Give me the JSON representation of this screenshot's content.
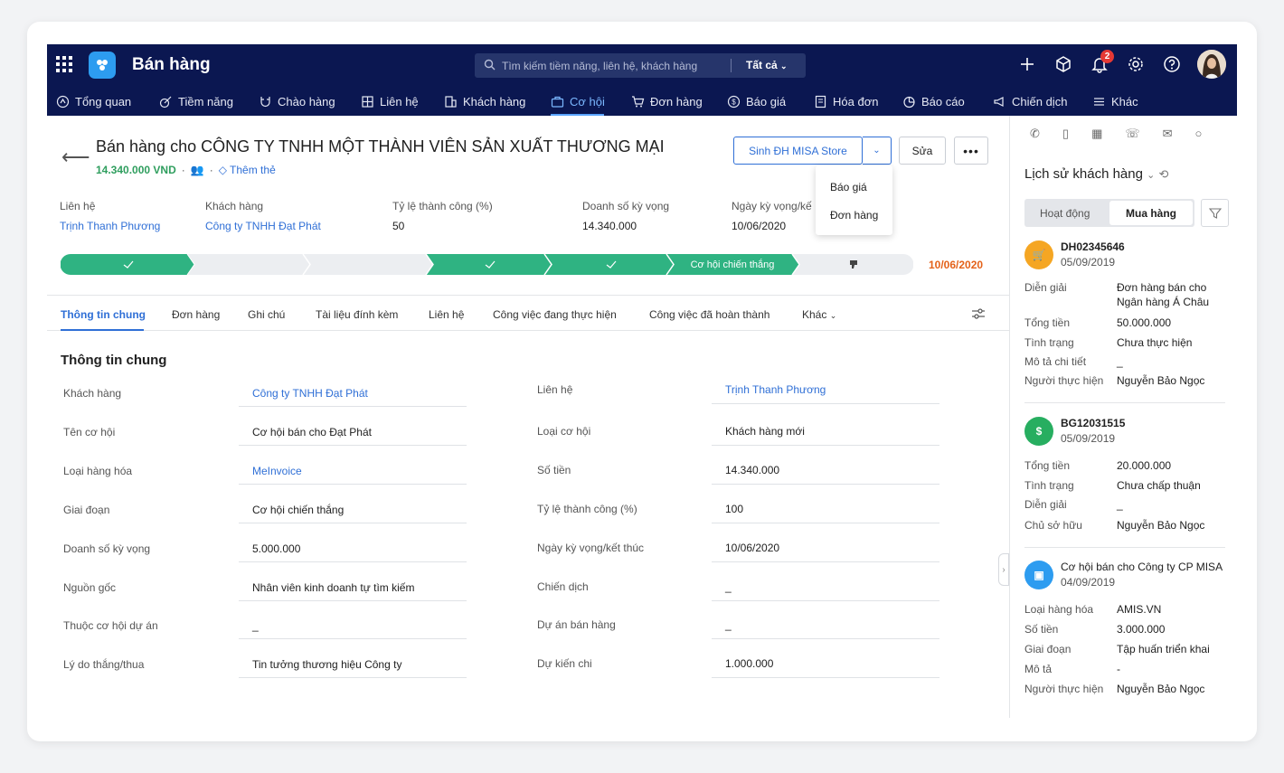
{
  "app": {
    "name": "Bán hàng"
  },
  "search": {
    "placeholder": "Tìm kiếm tiềm năng, liên hệ, khách hàng",
    "scope": "Tất cả"
  },
  "notifications": {
    "count": "2"
  },
  "nav": [
    {
      "label": "Tổng quan",
      "icon": "home-icon"
    },
    {
      "label": "Tiềm năng",
      "icon": "target-icon"
    },
    {
      "label": "Chào hàng",
      "icon": "magnet-icon"
    },
    {
      "label": "Liên hệ",
      "icon": "contact-icon"
    },
    {
      "label": "Khách hàng",
      "icon": "building-icon"
    },
    {
      "label": "Cơ hội",
      "icon": "briefcase-icon",
      "active": true
    },
    {
      "label": "Đơn hàng",
      "icon": "cart-icon"
    },
    {
      "label": "Báo giá",
      "icon": "dollar-icon"
    },
    {
      "label": "Hóa đơn",
      "icon": "invoice-icon"
    },
    {
      "label": "Báo cáo",
      "icon": "pie-icon"
    },
    {
      "label": "Chiến dịch",
      "icon": "megaphone-icon"
    },
    {
      "label": "Khác",
      "icon": "menu-icon"
    }
  ],
  "header": {
    "title": "Bán hàng cho CÔNG TY TNHH MỘT THÀNH VIÊN SẢN XUẤT THƯƠNG MẠI",
    "amount": "14.340.000 VND",
    "add_tag": "Thêm thẻ",
    "primary_button": "Sinh ĐH MISA Store",
    "edit_button": "Sửa",
    "more_button": "•••",
    "dropdown": [
      "Báo giá",
      "Đơn hàng"
    ]
  },
  "facts": [
    {
      "label": "Liên hệ",
      "value": "Trịnh Thanh Phương",
      "link": true
    },
    {
      "label": "Khách hàng",
      "value": "Công ty TNHH Đạt Phát",
      "link": true
    },
    {
      "label": "Tỷ lệ thành công (%)",
      "value": "50"
    },
    {
      "label": "Doanh số kỳ vọng",
      "value": "14.340.000"
    },
    {
      "label": "Ngày kỳ vọng/kế",
      "value": "10/06/2020"
    }
  ],
  "stages": {
    "won_label": "Cơ hội chiến thắng",
    "date": "10/06/2020",
    "colors": {
      "done": "#2fb382",
      "pending": "#eceef1"
    }
  },
  "tabs": [
    "Thông tin chung",
    "Đơn hàng",
    "Ghi chú",
    "Tài liệu đính kèm",
    "Liên hệ",
    "Công việc đang thực hiện",
    "Công việc đã hoàn thành",
    "Khác"
  ],
  "section": {
    "title": "Thông tin chung"
  },
  "left_fields": [
    {
      "label": "Khách hàng",
      "value": "Công ty TNHH Đạt Phát",
      "link": true
    },
    {
      "label": "Tên cơ hội",
      "value": "Cơ hội bán cho Đạt Phát"
    },
    {
      "label": "Loại hàng hóa",
      "value": "MeInvoice",
      "link": true
    },
    {
      "label": "Giai đoạn",
      "value": "Cơ hội chiến thắng"
    },
    {
      "label": "Doanh số kỳ vọng",
      "value": "5.000.000"
    },
    {
      "label": "Nguồn gốc",
      "value": "Nhân viên kinh doanh tự tìm kiếm"
    },
    {
      "label": "Thuộc cơ hội dự án",
      "value": "_"
    },
    {
      "label": "Lý do thắng/thua",
      "value": "Tin tưởng thương hiệu Công ty"
    }
  ],
  "right_fields": [
    {
      "label": "Liên hệ",
      "value": "Trịnh Thanh Phương",
      "link": true
    },
    {
      "label": "Loại cơ hội",
      "value": "Khách hàng mới"
    },
    {
      "label": "Số tiền",
      "value": "14.340.000"
    },
    {
      "label": "Tỷ lệ thành công (%)",
      "value": "100"
    },
    {
      "label": "Ngày kỳ vọng/kết thúc",
      "value": "10/06/2020"
    },
    {
      "label": "Chiến dịch",
      "value": "_"
    },
    {
      "label": "Dự án bán hàng",
      "value": "_"
    },
    {
      "label": "Dự kiến chi",
      "value": "1.000.000"
    }
  ],
  "side": {
    "title": "Lịch sử khách hàng",
    "seg_a": "Hoạt động",
    "seg_b": "Mua hàng",
    "items": [
      {
        "code": "DH02345646",
        "date": "05/09/2019",
        "icon_color": "#f5a623",
        "rows": [
          [
            "Diễn giải",
            "Đơn hàng bán cho"
          ],
          [
            "",
            "Ngân hàng Á Châu"
          ],
          [
            "Tổng tiền",
            "50.000.000"
          ],
          [
            "Tình trạng",
            "Chưa thực hiện"
          ],
          [
            "Mô tả chi tiết",
            "_"
          ],
          [
            "Người thực hiện",
            "Nguyễn Bảo Ngọc"
          ]
        ]
      },
      {
        "code": "BG12031515",
        "date": "05/09/2019",
        "icon_color": "#27ae60",
        "rows": [
          [
            "Tổng tiền",
            "20.000.000"
          ],
          [
            "Tình trạng",
            "Chưa chấp thuận"
          ],
          [
            "Diễn giải",
            "_"
          ],
          [
            "Chủ sở hữu",
            "Nguyễn Bảo Ngọc"
          ]
        ]
      },
      {
        "code": "Cơ hội bán cho Công ty CP MISA",
        "date": "04/09/2019",
        "icon_color": "#2d9cf0",
        "rows": [
          [
            "Loại hàng hóa",
            "AMIS.VN"
          ],
          [
            "Số tiền",
            "3.000.000"
          ],
          [
            "Giai đoạn",
            "Tập huấn triển khai"
          ],
          [
            "Mô tả",
            "-"
          ],
          [
            "Người thực hiện",
            "Nguyễn Bảo Ngọc"
          ]
        ]
      }
    ]
  }
}
